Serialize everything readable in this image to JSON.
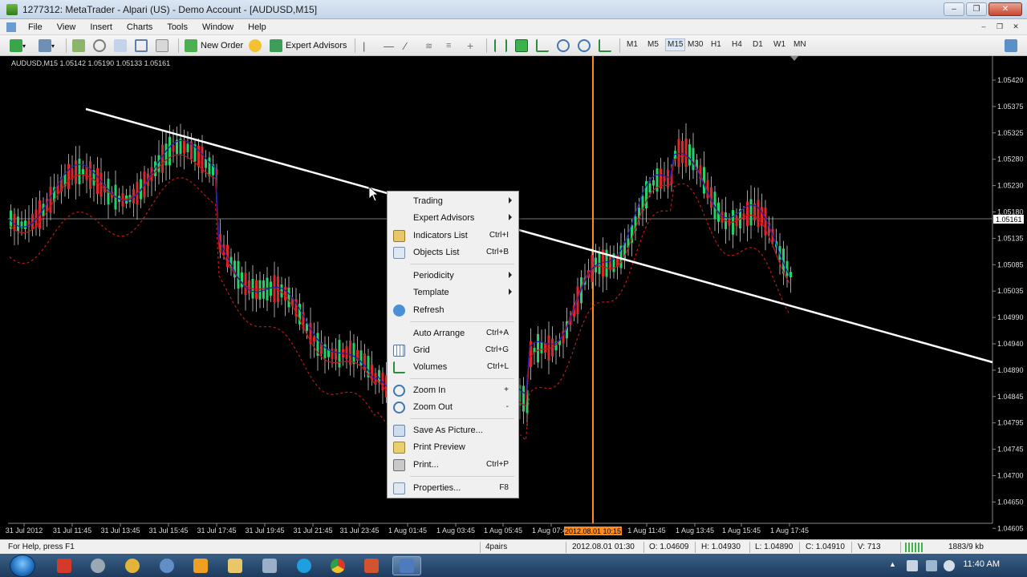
{
  "window": {
    "title": "1277312: MetaTrader - Alpari (US) - Demo Account - [AUDUSD,M15]"
  },
  "menubar": [
    "File",
    "View",
    "Insert",
    "Charts",
    "Tools",
    "Window",
    "Help"
  ],
  "toolbar": {
    "new_order_label": "New Order",
    "expert_advisors_label": "Expert Advisors",
    "timeframes": [
      "M1",
      "M5",
      "M15",
      "M30",
      "H1",
      "H4",
      "D1",
      "W1",
      "MN"
    ],
    "active_timeframe": "M15"
  },
  "chart": {
    "symbol_info": "AUDUSD,M15  1.05142 1.05190 1.05133 1.05161",
    "current_price": "1.05161",
    "price_labels": [
      "1.05420",
      "1.05375",
      "1.05325",
      "1.05280",
      "1.05230",
      "1.05180",
      "1.05135",
      "1.05085",
      "1.05035",
      "1.04990",
      "1.04940",
      "1.04890",
      "1.04845",
      "1.04795",
      "1.04745",
      "1.04700",
      "1.04650",
      "1.04605"
    ],
    "time_labels": [
      "31 Jul 2012",
      "31 Jul 11:45",
      "31 Jul 13:45",
      "31 Jul 15:45",
      "31 Jul 17:45",
      "31 Jul 19:45",
      "31 Jul 21:45",
      "31 Jul 23:45",
      "1 Aug 01:45",
      "1 Aug 03:45",
      "1 Aug 05:45",
      "1 Aug 07:45",
      "1 Aug 11:45",
      "1 Aug 13:45",
      "1 Aug 15:45",
      "1 Aug 17:45"
    ],
    "crosshair_time": "2012.08.01 10:15",
    "colors": {
      "bull": "#22d36a",
      "bear": "#e0262b",
      "trendline": "#ffffff",
      "vline": "#ff8c1a",
      "ma_red": "#c01818",
      "ma_blue": "#2020b0"
    }
  },
  "context_menu": {
    "items": [
      {
        "label": "Trading",
        "shortcut": "",
        "submenu": true,
        "icon": ""
      },
      {
        "label": "Expert Advisors",
        "shortcut": "",
        "submenu": true,
        "icon": ""
      },
      {
        "label": "Indicators List",
        "shortcut": "Ctrl+I",
        "submenu": false,
        "icon": "indicators-list-icon"
      },
      {
        "label": "Objects List",
        "shortcut": "Ctrl+B",
        "submenu": false,
        "icon": "objects-list-icon"
      },
      {
        "label": "Periodicity",
        "shortcut": "",
        "submenu": true,
        "icon": ""
      },
      {
        "label": "Template",
        "shortcut": "",
        "submenu": true,
        "icon": ""
      },
      {
        "label": "Refresh",
        "shortcut": "",
        "submenu": false,
        "icon": "refresh-icon"
      },
      {
        "label": "Auto Arrange",
        "shortcut": "Ctrl+A",
        "submenu": false,
        "icon": ""
      },
      {
        "label": "Grid",
        "shortcut": "Ctrl+G",
        "submenu": false,
        "icon": "grid-icon"
      },
      {
        "label": "Volumes",
        "shortcut": "Ctrl+L",
        "submenu": false,
        "icon": "volumes-icon"
      },
      {
        "label": "Zoom In",
        "shortcut": "+",
        "submenu": false,
        "icon": "zoom-in-icon"
      },
      {
        "label": "Zoom Out",
        "shortcut": "-",
        "submenu": false,
        "icon": "zoom-out-icon"
      },
      {
        "label": "Save As Picture...",
        "shortcut": "",
        "submenu": false,
        "icon": "save-picture-icon"
      },
      {
        "label": "Print Preview",
        "shortcut": "",
        "submenu": false,
        "icon": "print-preview-icon"
      },
      {
        "label": "Print...",
        "shortcut": "Ctrl+P",
        "submenu": false,
        "icon": "print-icon"
      },
      {
        "label": "Properties...",
        "shortcut": "F8",
        "submenu": false,
        "icon": "properties-icon"
      }
    ]
  },
  "statusbar": {
    "help": "For Help, press F1",
    "profile": "4pairs",
    "datetime": "2012.08.01 01:30",
    "open": "O: 1.04609",
    "high": "H: 1.04930",
    "low": "L: 1.04890",
    "close": "C: 1.04910",
    "volume": "V: 713",
    "traffic": "1883/9 kb"
  },
  "taskbar": {
    "clock": "11:40 AM"
  }
}
